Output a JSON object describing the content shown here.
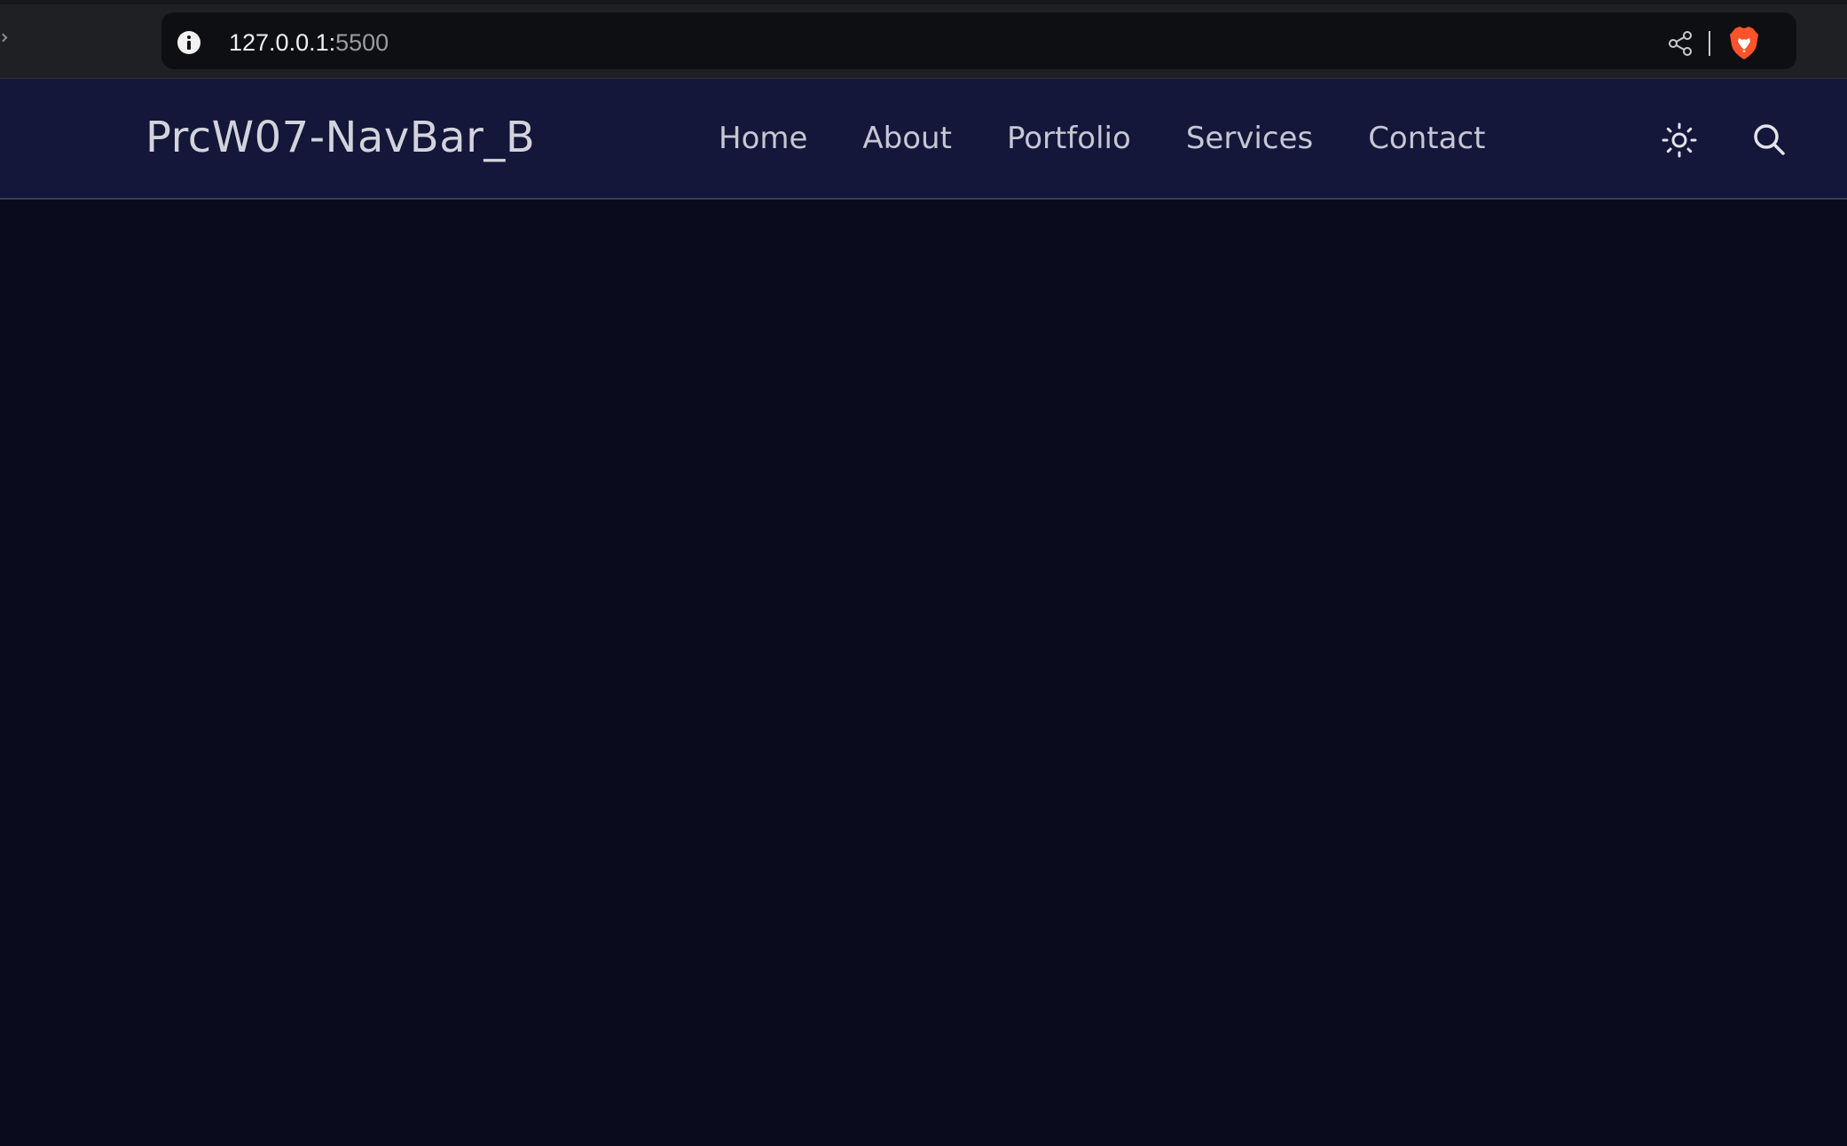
{
  "browser": {
    "url_host": "127.0.0.1:",
    "url_port": "5500",
    "icons": {
      "info": "info-icon",
      "share": "share-icon",
      "brave": "brave-lion-icon"
    }
  },
  "navbar": {
    "brand": "PrcW07-NavBar_B",
    "links": [
      {
        "label": "Home"
      },
      {
        "label": "About"
      },
      {
        "label": "Portfolio"
      },
      {
        "label": "Services"
      },
      {
        "label": "Contact"
      }
    ],
    "icons": {
      "theme_toggle": "sun-icon",
      "search": "search-icon"
    }
  },
  "colors": {
    "navbar_bg": "#14163a",
    "page_bg": "#0b0b1e",
    "text": "#c6c7d2",
    "brave_orange": "#fb542b"
  }
}
